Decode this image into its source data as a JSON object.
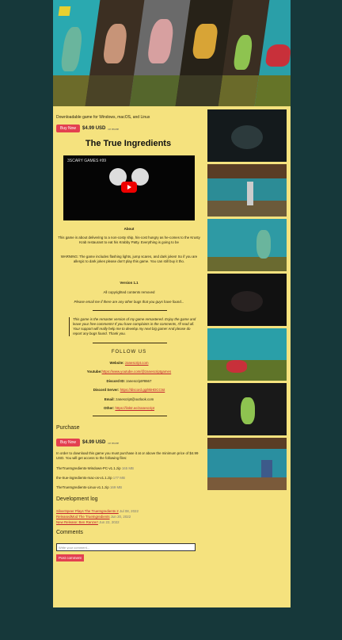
{
  "header": {
    "tagline": "Downloadable game for Windows, macOS, and Linux"
  },
  "buy": {
    "button": "Buy Now",
    "price": "$4.99 USD",
    "or_more": "or more"
  },
  "game": {
    "title": "The True Ingredients"
  },
  "video": {
    "channel": "3SCARY GAMES #99"
  },
  "about": {
    "heading": "About",
    "p1": "This game is about delivering to a non-costy ship, his-cost hungry as he-comes to the Krusty Krab restaurant to eat his Krabby Patty. Everything is going to be",
    "warning": "WARNING: The game includes flashing lights, jump scares, and dark jokes! So if you are allergic to dark jokes please don't play this game. You can still buy it tho.",
    "version": "Version 1.1",
    "copyright": "All copyrighted contents removed",
    "report": "Please email me if there are any other bugs that you guys have found...",
    "quote": "This game is the remaster version of my game remastered. Enjoy the game and leave your free comments! If you have complaints in the comments, I'll read all. Your support will really help me to develop my next big game! And please do report any bugs found. Thank you."
  },
  "follow": {
    "heading": "FOLLOW US",
    "website_label": "Website:",
    "website": "zanescript.com",
    "youtube_label": "Youtube:",
    "youtube": "https://www.youtube.com/@zanescriptgames",
    "discord_id_label": "Discord ID:",
    "discord_id": "zanescript#8667",
    "discord_server_label": "Discord Server:",
    "discord_server": "https://discord.gg/8kHDCCtst",
    "email_label": "Email:",
    "email": "zanescript@outlook.com",
    "other_label": "Other:",
    "other": "https://linktr.ee/zanescript"
  },
  "purchase": {
    "heading": "Purchase",
    "note": "In order to download this game you must purchase it at or above the minimum price of $4.99 USD. You will get access to the following files:",
    "files": [
      {
        "name": "TheTrueIngredients-Windows-PC-v1.1.zip",
        "size": "165 MB"
      },
      {
        "name": "the-true-ingredients-mac-os-v1.1.zip",
        "size": "177 MB"
      },
      {
        "name": "TheTrueIngredients-Linux-v1.1.zip",
        "size": "169 MB"
      }
    ]
  },
  "devlog": {
    "heading": "Development log",
    "entries": [
      {
        "title": "SilverSpeer Plays The TrueIngredients 2",
        "date": "Jul 08, 2022"
      },
      {
        "title": "ReleasedMod The TrueIngredients",
        "date": "Jun 20, 2022"
      },
      {
        "title": "New Release: Ben Ranzer!",
        "date": "Jun 22, 2022"
      }
    ]
  },
  "comments": {
    "heading": "Comments",
    "placeholder": "Write your comment...",
    "post": "Post comment"
  },
  "colors": {
    "page": "#f5e27e",
    "background": "#16383a",
    "accent": "#e34050",
    "link": "#c3202e"
  }
}
